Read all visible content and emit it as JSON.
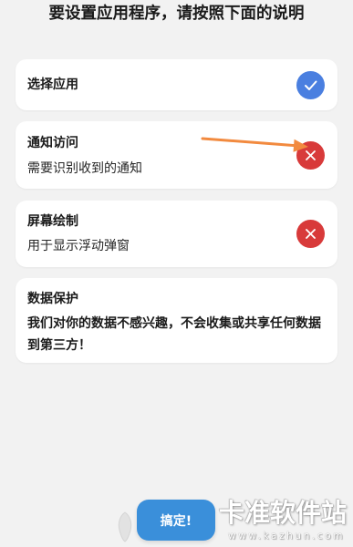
{
  "header": {
    "title": "要设置应用程序，请按照下面的说明"
  },
  "steps": [
    {
      "title": "选择应用",
      "status_icon": "check-icon"
    },
    {
      "title": "通知访问",
      "subtitle": "需要识别收到的通知",
      "status_icon": "close-icon"
    },
    {
      "title": "屏幕绘制",
      "subtitle": "用于显示浮动弹窗",
      "status_icon": "close-icon"
    }
  ],
  "privacy": {
    "title": "数据保护",
    "body": "我们对你的数据不感兴趣，不会收集或共享任何数据到第三方！"
  },
  "done_button": {
    "label": "搞定!"
  },
  "annotation": {
    "arrow_icon": "arrow-right-icon"
  },
  "watermark": {
    "name": "卡准软件站",
    "url": "www.kazhun.com",
    "logo_icon": "kazhun-logo-icon"
  },
  "colors": {
    "background": "#F2F2F2",
    "card": "#FFFFFF",
    "text": "#1A1A1A",
    "granted": "#4A7FE0",
    "not_granted": "#D83A3A",
    "button": "#3A8FDA",
    "arrow": "#F28A3F"
  }
}
